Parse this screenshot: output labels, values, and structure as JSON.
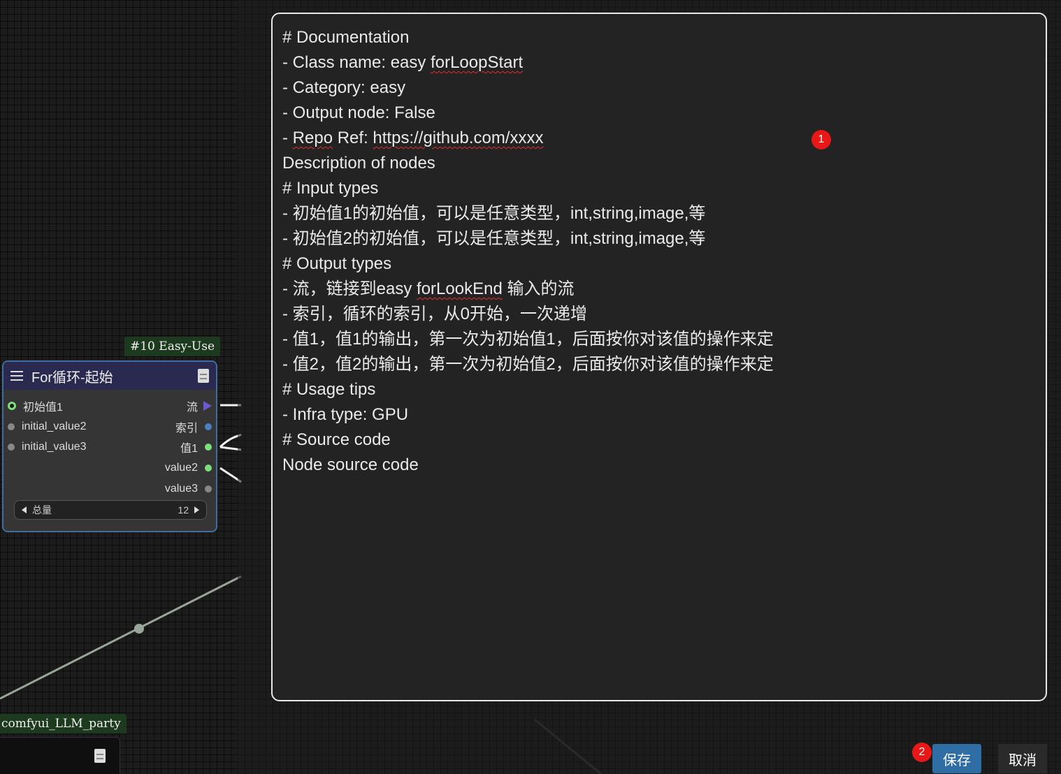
{
  "canvas": {
    "group_badges": {
      "easyuse": "#10 Easy-Use",
      "llm_party": "comfyui_LLM_party"
    },
    "node_forloop": {
      "title": "For循环-起始",
      "inputs": [
        "初始值1",
        "initial_value2",
        "initial_value3"
      ],
      "outputs": [
        "流",
        "索引",
        "值1",
        "value2",
        "value3"
      ],
      "widget": {
        "label": "总量",
        "value": "12"
      }
    }
  },
  "doc_editor": {
    "lines": [
      [
        "# Documentation"
      ],
      [
        "- Class name: easy ",
        {
          "t": "forLoopStart",
          "s": true
        }
      ],
      [
        "- Category: easy"
      ],
      [
        "- Output node: False"
      ],
      [
        "- ",
        {
          "t": "Repo",
          "s": true
        },
        " Ref: ",
        {
          "t": "https://github.com/xxxx",
          "s": true
        }
      ],
      [
        "Description of nodes"
      ],
      [
        "# Input types"
      ],
      [
        "- 初始值1的初始值，可以是任意类型，int,string,image,等"
      ],
      [
        "- 初始值2的初始值，可以是任意类型，int,string,image,等"
      ],
      [
        "# Output types"
      ],
      [
        "- 流，链接到easy ",
        {
          "t": "forLookEnd",
          "s": true
        },
        " 输入的流"
      ],
      [
        "- 索引，循环的索引，从0开始，一次递增"
      ],
      [
        "- 值1，值1的输出，第一次为初始值1，后面按你对该值的操作来定"
      ],
      [
        "- 值2，值2的输出，第一次为初始值2，后面按你对该值的操作来定"
      ],
      [
        "# Usage tips"
      ],
      [
        "- Infra type: GPU"
      ],
      [
        "# Source code"
      ],
      [
        "Node source code"
      ]
    ]
  },
  "markers": {
    "m1": "1",
    "m2": "2"
  },
  "buttons": {
    "save_label": "保存",
    "cancel_label": "取消"
  },
  "colors": {
    "node_border": "#3f6d9e",
    "save_button": "#2f6ea4",
    "marker": "#e81818"
  }
}
